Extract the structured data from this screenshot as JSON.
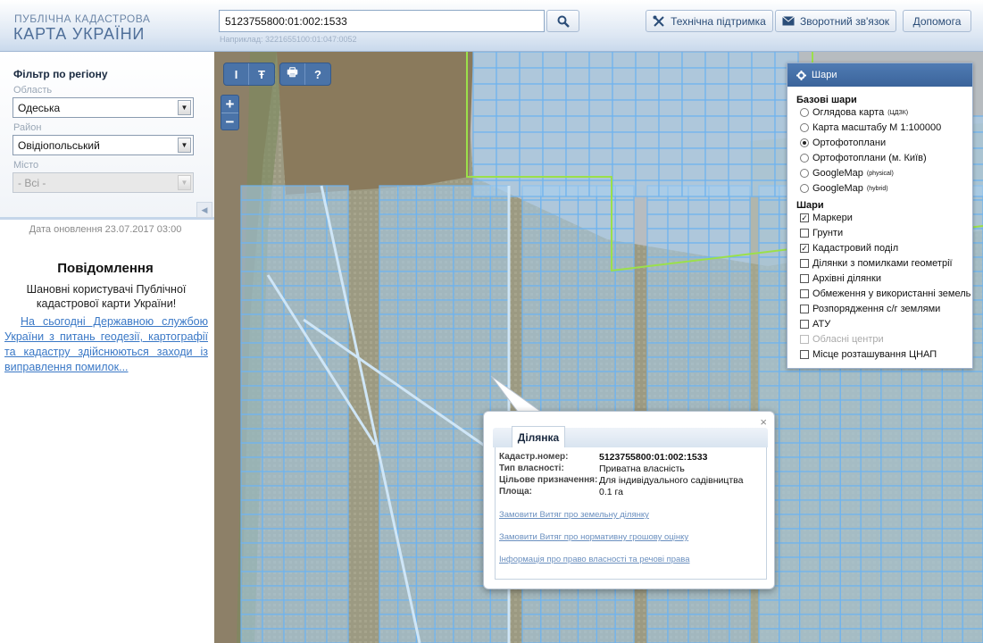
{
  "header": {
    "logo_top": "ПУБЛІЧНА КАДАСТРОВА",
    "logo_bottom": "КАРТА УКРАЇНИ",
    "search_value": "5123755800:01:002:1533",
    "search_hint": "Наприклад: 3221655100:01:047:0052",
    "support_label": "Технічна підтримка",
    "feedback_label": "Зворотний зв'язок",
    "help_label": "Допомога"
  },
  "filter": {
    "title": "Фільтр по регіону",
    "oblast_label": "Область",
    "oblast_value": "Одеська",
    "raion_label": "Район",
    "raion_value": "Овідіопольський",
    "city_label": "Місто",
    "city_value": "- Всі -"
  },
  "sidebar": {
    "update_date": "Дата оновлення  23.07.2017 03:00",
    "notice_title": "Повідомлення",
    "notice_text": "Шановні користувачі Публічної кадастрової карти України!",
    "notice_link": "На сьогодні Державною службою України з питань геодезії, картографії та кадастру здійснюються заходи із виправлення помилок..."
  },
  "map_tools": {
    "measure_line": "I",
    "measure_area": "Ŧ",
    "print": "🖶",
    "info": "?",
    "zoom_in": "+",
    "zoom_out": "−"
  },
  "layers": {
    "title": "Шари",
    "base_title": "Базові шари",
    "base": [
      {
        "label": "Оглядова карта",
        "sup": "(ЦДЗК)",
        "selected": false
      },
      {
        "label": "Карта масштабу М 1:100000",
        "sup": "",
        "selected": false
      },
      {
        "label": "Ортофотоплани",
        "sup": "",
        "selected": true
      },
      {
        "label": "Ортофотоплани (м. Київ)",
        "sup": "",
        "selected": false
      },
      {
        "label": "GoogleMap",
        "sup": "(physical)",
        "selected": false
      },
      {
        "label": "GoogleMap",
        "sup": "(hybrid)",
        "selected": false
      }
    ],
    "overlay_title": "Шари",
    "overlay": [
      {
        "label": "Маркери",
        "checked": true,
        "disabled": false
      },
      {
        "label": "Грунти",
        "checked": false,
        "disabled": false
      },
      {
        "label": "Кадастровий поділ",
        "checked": true,
        "disabled": false
      },
      {
        "label": "Ділянки з помилками геометрії",
        "checked": false,
        "disabled": false
      },
      {
        "label": "Архівні ділянки",
        "checked": false,
        "disabled": false
      },
      {
        "label": "Обмеження у використанні земель",
        "checked": false,
        "disabled": false
      },
      {
        "label": "Розпорядження с/г землями",
        "checked": false,
        "disabled": false
      },
      {
        "label": "АТУ",
        "checked": false,
        "disabled": false
      },
      {
        "label": "Обласні центри",
        "checked": false,
        "disabled": true
      },
      {
        "label": "Місце розташування ЦНАП",
        "checked": false,
        "disabled": false
      }
    ]
  },
  "popup": {
    "tab": "Ділянка",
    "close": "×",
    "rows": [
      {
        "key": "Кадастр.номер:",
        "value": "5123755800:01:002:1533"
      },
      {
        "key": "Тип власності:",
        "value": "Приватна власність"
      },
      {
        "key": "Цільове призначення:",
        "value": "Для індивідуального садівництва"
      },
      {
        "key": "Площа:",
        "value": "0.1 га"
      }
    ],
    "links": [
      "Замовити Витяг про земельну ділянку",
      "Замовити Витяг про нормативну грошову оцінку",
      "Інформація про право власності та речові права"
    ]
  },
  "colors": {
    "accent": "#4a73a8",
    "parcel_fill": "#a7d0f0",
    "parcel_line": "#6fb3ee",
    "boundary": "#9be04a"
  }
}
